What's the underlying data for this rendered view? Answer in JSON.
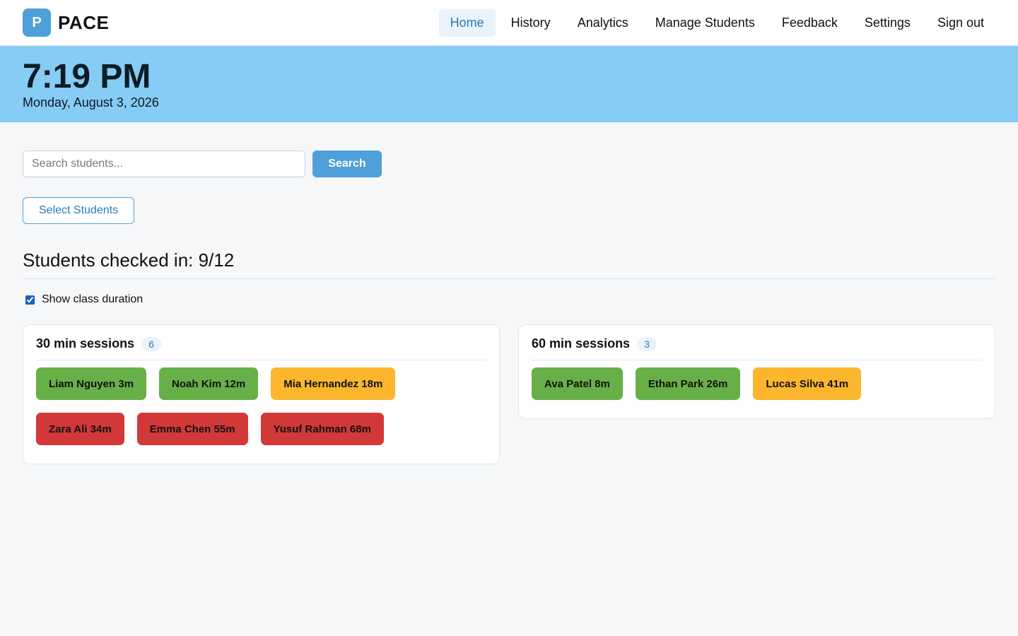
{
  "brand": {
    "logo_letter": "P",
    "name": "PACE"
  },
  "nav": [
    {
      "label": "Home",
      "active": true
    },
    {
      "label": "History"
    },
    {
      "label": "Analytics"
    },
    {
      "label": "Manage Students"
    },
    {
      "label": "Feedback"
    },
    {
      "label": "Settings"
    },
    {
      "label": "Sign out"
    }
  ],
  "clock": {
    "time": "7:19 PM",
    "date": "Monday, August 3, 2026"
  },
  "search": {
    "placeholder": "Search students...",
    "button_label": "Search"
  },
  "select_students_label": "Select Students",
  "checked_in_title": "Students checked in: 9/12",
  "show_duration": {
    "label": "Show class duration",
    "checked": true
  },
  "colors": {
    "green": "#67b047",
    "amber": "#fbb62e",
    "red": "#d23838",
    "accent": "#4f9fd8"
  },
  "panels": [
    {
      "title": "30 min sessions",
      "count": "6",
      "students": [
        {
          "label": "Liam Nguyen 3m",
          "status": "green"
        },
        {
          "label": "Noah Kim 12m",
          "status": "green"
        },
        {
          "label": "Mia Hernandez 18m",
          "status": "amber"
        },
        {
          "label": "Zara Ali 34m",
          "status": "red"
        },
        {
          "label": "Emma Chen 55m",
          "status": "red"
        },
        {
          "label": "Yusuf Rahman 68m",
          "status": "red"
        }
      ]
    },
    {
      "title": "60 min sessions",
      "count": "3",
      "students": [
        {
          "label": "Ava Patel 8m",
          "status": "green"
        },
        {
          "label": "Ethan Park 26m",
          "status": "green"
        },
        {
          "label": "Lucas Silva 41m",
          "status": "amber"
        }
      ]
    }
  ]
}
